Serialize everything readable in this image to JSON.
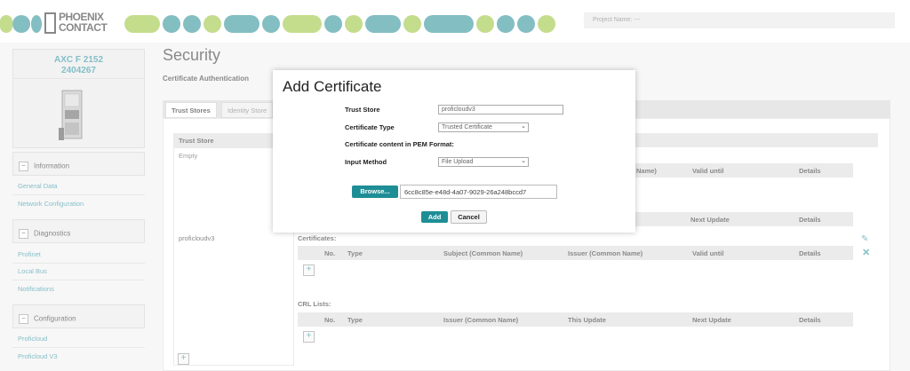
{
  "header": {
    "logo_text_line1": "PHOENIX",
    "logo_text_line2": "CONTACT",
    "project_label": "Project Name: ---",
    "colors": {
      "teal": "#2a8f96",
      "green": "#9ac43c"
    }
  },
  "device": {
    "name_line1": "AXC F 2152",
    "name_line2": "2404267"
  },
  "sidebar": {
    "sections": [
      {
        "title": "Information",
        "items": [
          "General Data",
          "Network Configuration"
        ]
      },
      {
        "title": "Diagnostics",
        "items": [
          "Profinet",
          "Local Bus",
          "Notifications"
        ]
      },
      {
        "title": "Configuration",
        "items": [
          "Proficloud",
          "Proficloud V3"
        ]
      }
    ]
  },
  "main": {
    "title": "Security",
    "subtitle": "Certificate Authentication",
    "tabs": [
      "Trust Stores",
      "Identity Store"
    ],
    "trust_store_header": "Trust Store",
    "trust_stores": [
      "Empty",
      "proficloudv3"
    ],
    "upper_headers": [
      "Name)",
      "Valid until",
      "Details"
    ],
    "upper_headers2": [
      "Next Update",
      "Details"
    ],
    "certificates_label": "Certificates:",
    "cert_headers": [
      "No.",
      "Type",
      "Subject (Common Name)",
      "Issuer (Common Name)",
      "Valid until",
      "Details"
    ],
    "crl_label": "CRL Lists:",
    "crl_headers": [
      "No.",
      "Type",
      "Issuer (Common Name)",
      "This Update",
      "Next Update",
      "Details"
    ]
  },
  "modal": {
    "title": "Add Certificate",
    "trust_store_label": "Trust Store",
    "trust_store_value": "proficloudv3",
    "cert_type_label": "Certificate Type",
    "cert_type_value": "Trusted Certificate",
    "pem_label": "Certificate content in PEM Format:",
    "input_method_label": "Input Method",
    "input_method_value": "File Upload",
    "browse_label": "Browse...",
    "file_name": "6cc8c85e-e48d-4a07-9029-26a248bccd7",
    "add_label": "Add",
    "cancel_label": "Cancel"
  }
}
